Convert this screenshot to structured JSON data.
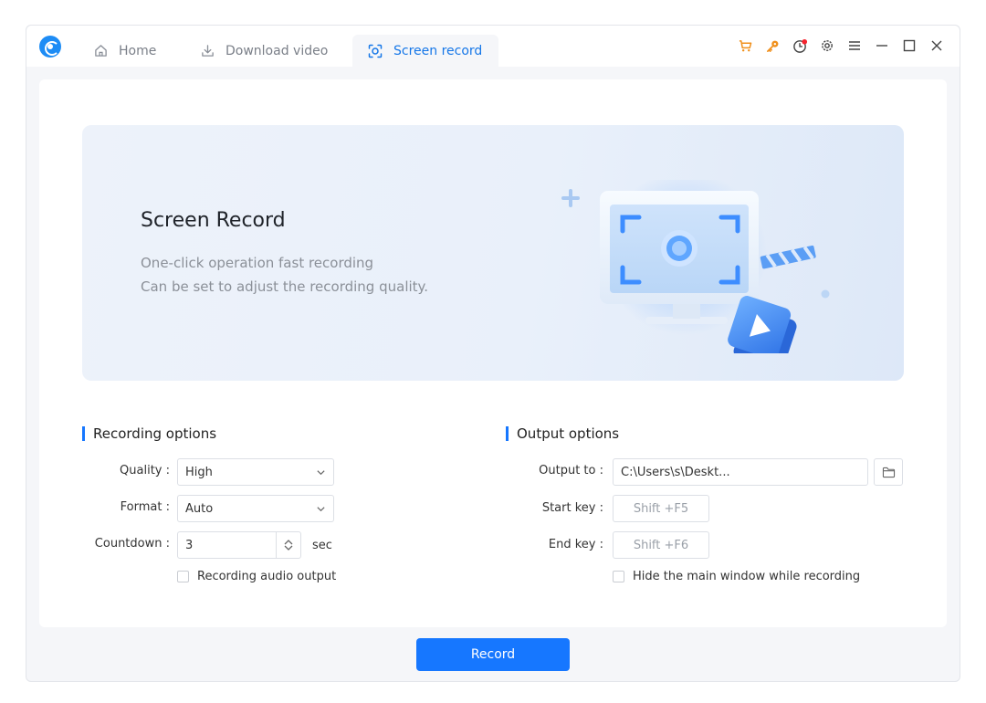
{
  "tabs": [
    {
      "label": "Home",
      "icon": "home-icon"
    },
    {
      "label": "Download video",
      "icon": "download-icon"
    },
    {
      "label": "Screen record",
      "icon": "screen-record-icon",
      "active": true
    }
  ],
  "titlebar_icons": [
    "cart-icon",
    "key-icon",
    "clock-icon",
    "gear-icon",
    "menu-icon",
    "minimize-icon",
    "maximize-icon",
    "close-icon"
  ],
  "hero": {
    "title": "Screen Record",
    "line1": "One-click operation fast recording",
    "line2": "Can be set to adjust the recording quality."
  },
  "recording": {
    "title": "Recording options",
    "quality_label": "Quality :",
    "quality_value": "High",
    "format_label": "Format :",
    "format_value": "Auto",
    "countdown_label": "Countdown :",
    "countdown_value": "3",
    "countdown_unit": "sec",
    "audio_label": "Recording audio output",
    "audio_checked": false
  },
  "output": {
    "title": "Output options",
    "output_label": "Output to :",
    "output_value": "C:\\Users\\s\\Deskt...",
    "start_label": "Start key :",
    "start_value": "Shift +F5",
    "end_label": "End key :",
    "end_value": "Shift +F6",
    "hide_label": "Hide the main window while recording",
    "hide_checked": false
  },
  "record_button": "Record",
  "colors": {
    "accent": "#1677ff",
    "active_tab_text": "#1677e8",
    "icon_orange": "#f0901c",
    "notify_red": "#f5222d"
  }
}
